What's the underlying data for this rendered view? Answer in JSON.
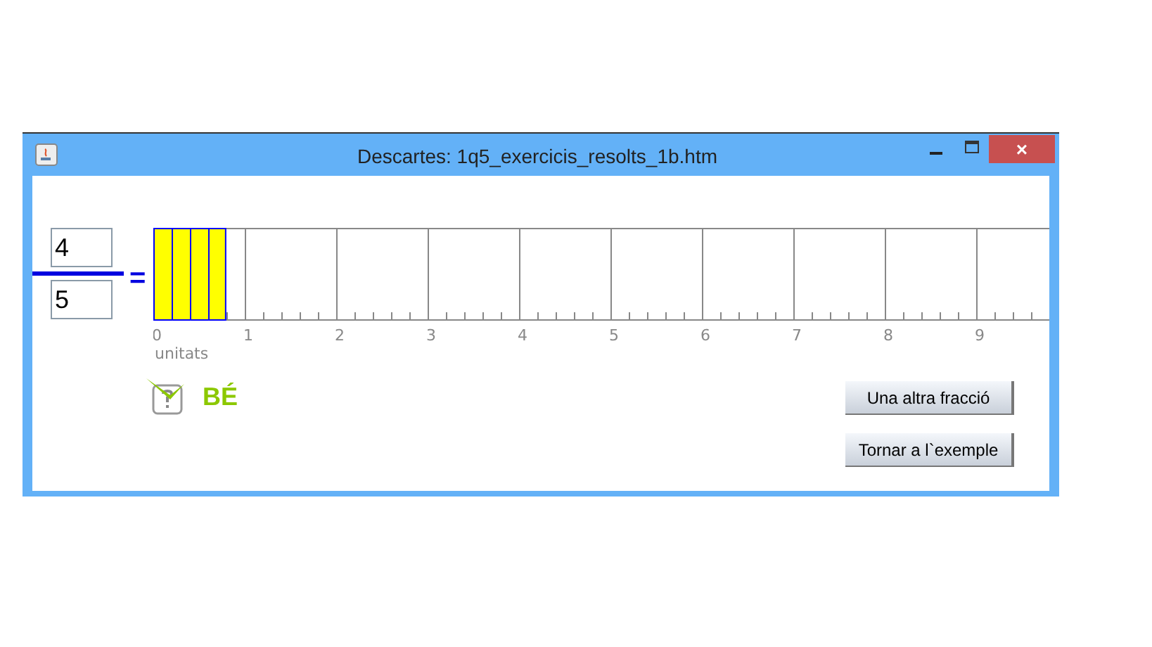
{
  "window": {
    "title": "Descartes: 1q5_exercicis_resolts_1b.htm",
    "close": "×"
  },
  "fraction": {
    "numerator": "4",
    "denominator": "5",
    "equals": "="
  },
  "ruler": {
    "level": 0.0815,
    "labels": [
      "0",
      "1",
      "2",
      "3",
      "4",
      "5",
      "6",
      "7",
      "8",
      "9"
    ],
    "unit_label": "unitats"
  },
  "feedback": {
    "text": "BÉ"
  },
  "buttons": [
    "Una altra fracció",
    "Tornar a l`exemple"
  ]
}
